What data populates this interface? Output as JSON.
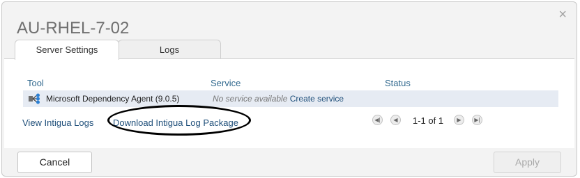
{
  "dialog": {
    "title": "AU-RHEL-7-02",
    "close_label": "×"
  },
  "tabs": [
    {
      "label": "Server Settings",
      "active": true
    },
    {
      "label": "Logs",
      "active": false
    }
  ],
  "table": {
    "headers": {
      "tool": "Tool",
      "service": "Service",
      "status": "Status"
    },
    "rows": [
      {
        "tool": "Microsoft Dependency Agent (9.0.5)",
        "tool_icon": "dependency-agent-icon",
        "service_text": "No service available",
        "service_link": "Create service",
        "status": ""
      }
    ]
  },
  "links": {
    "view_logs": "View Intigua Logs",
    "download_package": "Download Intigua Log Package"
  },
  "pagination": {
    "info": "1-1 of 1",
    "first_icon": "first-page-icon",
    "prev_icon": "previous-page-icon",
    "next_icon": "next-page-icon",
    "last_icon": "last-page-icon"
  },
  "buttons": {
    "cancel": "Cancel",
    "apply": "Apply"
  },
  "annotation": {
    "shape": "ellipse",
    "color": "#000000"
  }
}
